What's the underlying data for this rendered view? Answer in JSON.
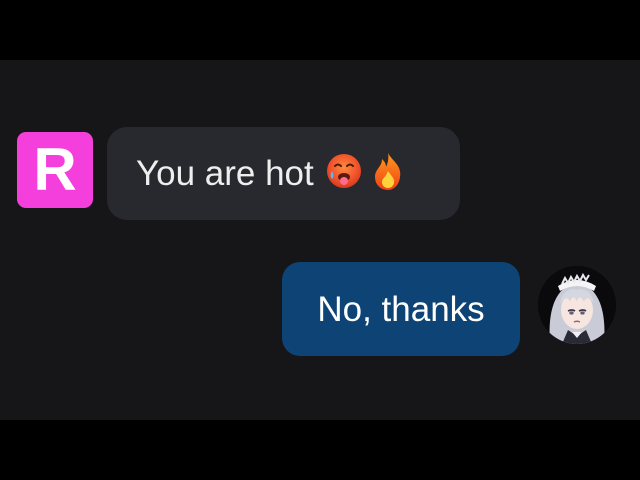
{
  "messages": [
    {
      "sender": "R",
      "text": "You are hot",
      "emojis": [
        "hot-face-emoji",
        "fire-emoji"
      ]
    },
    {
      "text": "No, thanks",
      "avatar": "anime-character-avatar"
    }
  ],
  "colors": {
    "background": "#161619",
    "letterbox": "#000000",
    "avatar_r": "#f43fdc",
    "incoming_bubble": "#28292e",
    "outgoing_bubble": "#0d4475",
    "text": "#eeeeee"
  }
}
